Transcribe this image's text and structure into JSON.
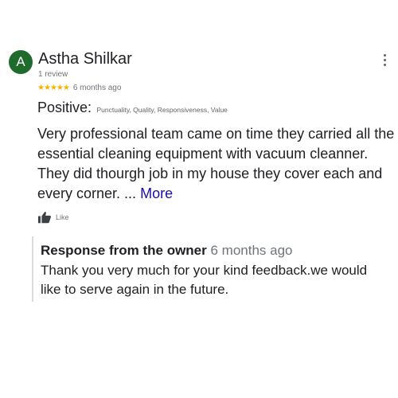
{
  "reviewer": {
    "avatar_letter": "A",
    "avatar_color": "#1f6b2c",
    "name": "Astha Shilkar",
    "review_count": "1 review",
    "menu_icon": "more-vert-icon"
  },
  "rating": {
    "stars_text": "★★★★★",
    "stars_value": 5,
    "star_color": "#f4b400",
    "date": "6 months ago"
  },
  "highlights": {
    "label": "Positive:",
    "tags": "Punctuality, Quality, Responsiveness, Value"
  },
  "review": {
    "text": "Very professional team came on time they carried all the essential cleaning equipment with vacuum cleanner. They did thourgh job in my house they cover each and every corner. ...",
    "more_label": "More",
    "more_color": "#1a0dab"
  },
  "actions": {
    "like_label": "Like",
    "like_icon": "thumbs-up-icon"
  },
  "owner_response": {
    "title": "Response from the owner",
    "date": "6 months ago",
    "text": "Thank you very much for your kind feedback.we would like to serve again in the future."
  }
}
